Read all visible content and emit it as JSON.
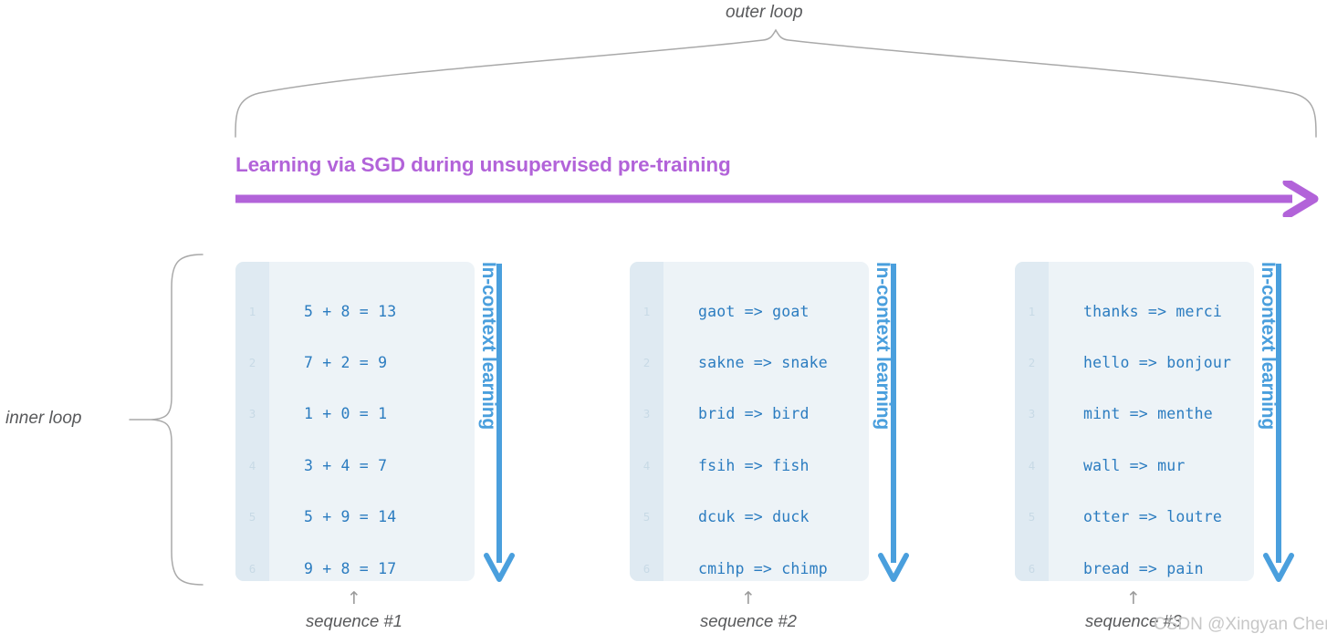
{
  "loops": {
    "outer_label": "outer loop",
    "inner_label": "inner loop"
  },
  "sgd": {
    "title": "Learning via SGD during unsupervised pre-training",
    "color": "#b263d9"
  },
  "icl": {
    "label": "In-context learning",
    "color": "#4a9fdd"
  },
  "panels": [
    {
      "caption": "sequence #1",
      "caption_arrow": "↑",
      "rows": [
        {
          "n": "1",
          "code": "5 + 8 = 13"
        },
        {
          "n": "2",
          "code": "7 + 2 = 9"
        },
        {
          "n": "3",
          "code": "1 + 0 = 1"
        },
        {
          "n": "4",
          "code": "3 + 4 = 7"
        },
        {
          "n": "5",
          "code": "5 + 9 = 14"
        },
        {
          "n": "6",
          "code": "9 + 8 = 17"
        }
      ]
    },
    {
      "caption": "sequence #2",
      "caption_arrow": "↑",
      "rows": [
        {
          "n": "1",
          "code": "gaot => goat"
        },
        {
          "n": "2",
          "code": "sakne => snake"
        },
        {
          "n": "3",
          "code": "brid => bird"
        },
        {
          "n": "4",
          "code": "fsih => fish"
        },
        {
          "n": "5",
          "code": "dcuk => duck"
        },
        {
          "n": "6",
          "code": "cmihp => chimp"
        }
      ]
    },
    {
      "caption": "sequence #3",
      "caption_arrow": "↑",
      "rows": [
        {
          "n": "1",
          "code": "thanks => merci"
        },
        {
          "n": "2",
          "code": "hello => bonjour"
        },
        {
          "n": "3",
          "code": "mint => menthe"
        },
        {
          "n": "4",
          "code": "wall => mur"
        },
        {
          "n": "5",
          "code": "otter => loutre"
        },
        {
          "n": "6",
          "code": "bread => pain"
        }
      ]
    }
  ],
  "watermark": "CSDN @Xingyan Chen"
}
